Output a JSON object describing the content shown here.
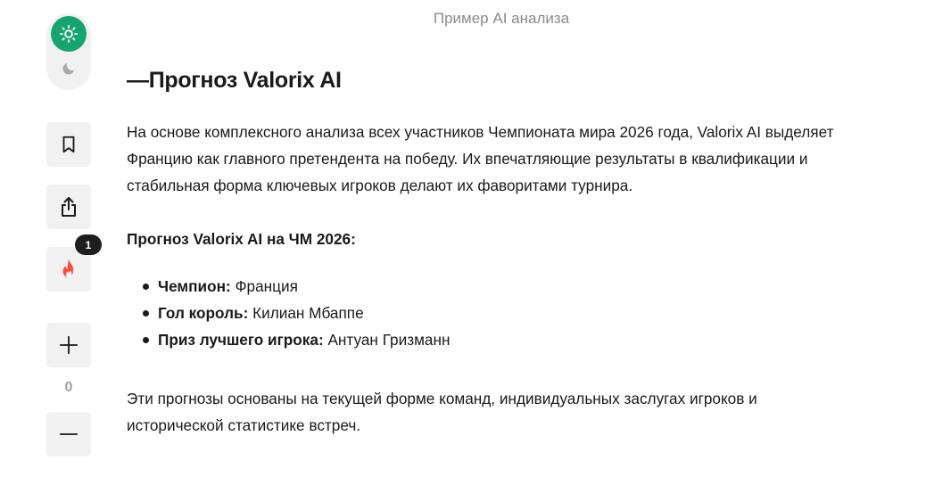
{
  "header": {
    "caption": "Пример AI анализа"
  },
  "sidebar": {
    "theme": {
      "light_icon": "sun-icon",
      "dark_icon": "moon-icon",
      "active": "light",
      "accent": "#17a56f"
    },
    "bookmark_icon": "bookmark-icon",
    "share_icon": "share-icon",
    "fire_icon": "fire-icon",
    "fire_badge": "1",
    "fire_color": "#ff4a3d",
    "plus_icon": "plus-icon",
    "vote_count": "0",
    "minus_icon": "minus-icon"
  },
  "article": {
    "title": "—Прогноз Valorix AI",
    "intro": "На основе комплексного анализа всех участников Чемпионата мира 2026 года, Valorix AI выделяет Францию как главного претендента на победу. Их впечатляющие результаты в квалификации и стабильная форма ключевых игроков делают их фаворитами турнира.",
    "forecast_heading": "Прогноз Valorix AI на ЧМ 2026:",
    "forecast": [
      {
        "label": "Чемпион:",
        "value": " Франция"
      },
      {
        "label": "Гол король:",
        "value": " Килиан Мбаппе"
      },
      {
        "label": "Приз лучшего игрока:",
        "value": " Антуан Гризманн"
      }
    ],
    "conclusion": "Эти прогнозы основаны на текущей форме команд, индивидуальных заслугах игроков и исторической статистике встреч."
  }
}
